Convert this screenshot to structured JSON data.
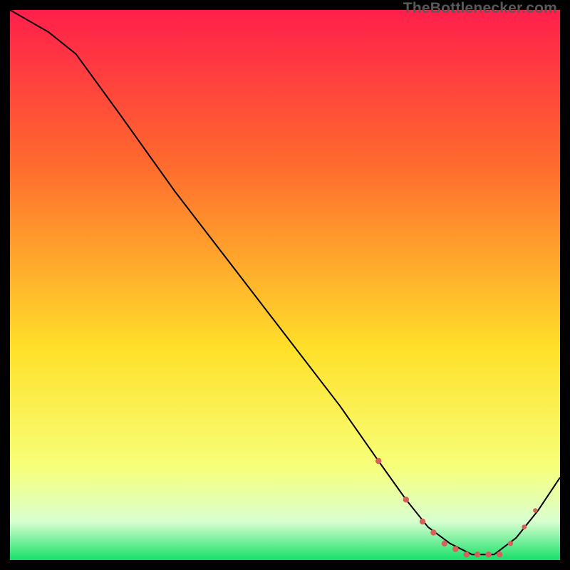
{
  "watermark": "TheBottlenecker.com",
  "colors": {
    "gradient_top": "#ff1f4b",
    "gradient_mid_upper": "#ff6a2e",
    "gradient_mid": "#ffe12a",
    "gradient_lower": "#f7ff7a",
    "gradient_band_pale": "#d9ffd0",
    "gradient_bottom": "#17e06a",
    "curve": "#000000",
    "marker": "#d6605a"
  },
  "chart_data": {
    "type": "line",
    "title": "",
    "xlabel": "",
    "ylabel": "",
    "xlim": [
      0,
      100
    ],
    "ylim": [
      0,
      100
    ],
    "series": [
      {
        "name": "bottleneck-curve",
        "x": [
          0,
          7,
          12,
          20,
          30,
          40,
          50,
          60,
          67,
          72,
          76,
          80,
          84,
          88,
          92,
          96,
          100
        ],
        "values": [
          100,
          96,
          92,
          81,
          67,
          54,
          41,
          28,
          18,
          11,
          6,
          3,
          1,
          1,
          4,
          9,
          15
        ]
      }
    ],
    "markers": {
      "name": "highlight-points",
      "x": [
        67,
        72,
        75,
        77,
        79,
        81,
        83,
        85,
        87,
        89,
        91,
        93.5,
        95.5
      ],
      "values": [
        18,
        11,
        7,
        5,
        3,
        2,
        1,
        1,
        1,
        1,
        3,
        6,
        9
      ],
      "size": [
        4.2,
        4.2,
        4.2,
        4.2,
        4.2,
        4.2,
        4.2,
        4.2,
        4.2,
        4.2,
        3.6,
        3.4,
        3.2
      ]
    }
  }
}
